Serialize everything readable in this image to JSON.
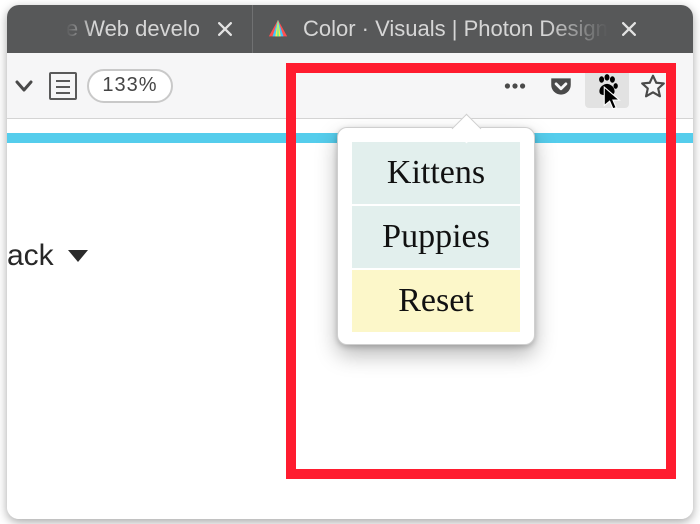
{
  "tabs": [
    {
      "title": "e Web develo"
    },
    {
      "title": "Color · Visuals | Photon Design"
    }
  ],
  "toolbar": {
    "zoom": "133%"
  },
  "page": {
    "visible_text": "ack"
  },
  "popup": {
    "items": [
      {
        "label": "Kittens",
        "variant": "normal"
      },
      {
        "label": "Puppies",
        "variant": "normal"
      },
      {
        "label": "Reset",
        "variant": "alt"
      }
    ]
  }
}
